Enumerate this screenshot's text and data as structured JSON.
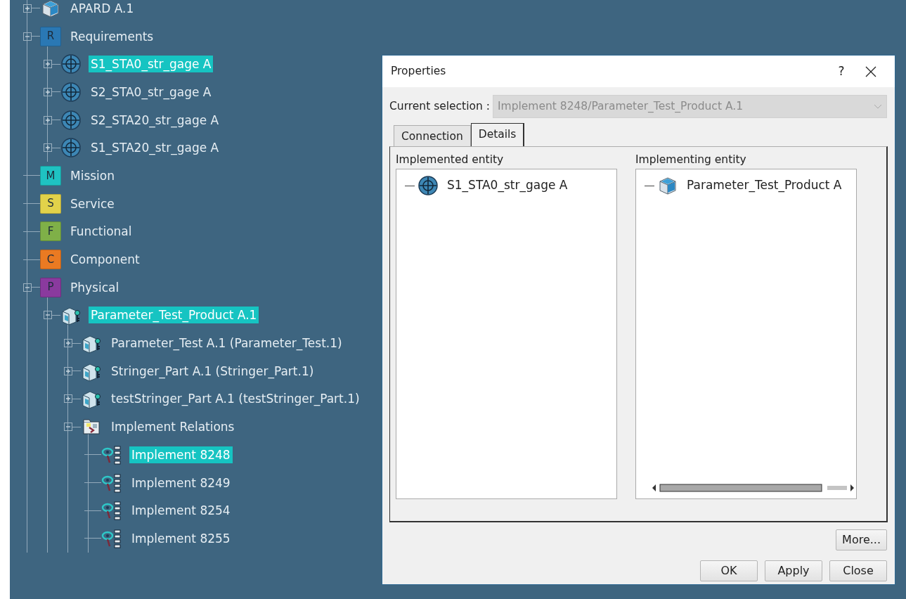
{
  "tree": [
    {
      "label": "APARD A.1",
      "kind": "product",
      "expanded": false,
      "selected": false
    },
    {
      "label": "Requirements",
      "kind": "letter",
      "letter": "R",
      "color": "#2a78b4",
      "expanded": true,
      "selected": false,
      "children": [
        {
          "label": "S1_STA0_str_gage A",
          "kind": "requirement",
          "expanded": false,
          "selected": true
        },
        {
          "label": "S2_STA0_str_gage A",
          "kind": "requirement",
          "expanded": false,
          "selected": false
        },
        {
          "label": "S2_STA20_str_gage A",
          "kind": "requirement",
          "expanded": false,
          "selected": false
        },
        {
          "label": "S1_STA20_str_gage A",
          "kind": "requirement",
          "expanded": false,
          "selected": false
        }
      ]
    },
    {
      "label": "Mission",
      "kind": "letter",
      "letter": "M",
      "color": "#1fc2c2",
      "selected": false
    },
    {
      "label": "Service",
      "kind": "letter",
      "letter": "S",
      "color": "#e2d24a",
      "selected": false
    },
    {
      "label": "Functional",
      "kind": "letter",
      "letter": "F",
      "color": "#7fb048",
      "selected": false
    },
    {
      "label": "Component",
      "kind": "letter",
      "letter": "C",
      "color": "#ea7a22",
      "selected": false
    },
    {
      "label": "Physical",
      "kind": "letter",
      "letter": "P",
      "color": "#8a3a9e",
      "expanded": true,
      "selected": false,
      "children": [
        {
          "label": "Parameter_Test_Product A.1",
          "kind": "part",
          "expanded": true,
          "selected": true,
          "children": [
            {
              "label": "Parameter_Test A.1 (Parameter_Test.1)",
              "kind": "part",
              "expanded": false,
              "selected": false
            },
            {
              "label": "Stringer_Part A.1 (Stringer_Part.1)",
              "kind": "part",
              "expanded": false,
              "selected": false
            },
            {
              "label": "testStringer_Part A.1 (testStringer_Part.1)",
              "kind": "part",
              "expanded": false,
              "selected": false
            },
            {
              "label": "Implement Relations",
              "kind": "folder",
              "expanded": true,
              "selected": false,
              "children": [
                {
                  "label": "Implement 8248",
                  "kind": "implement",
                  "selected": true
                },
                {
                  "label": "Implement 8249",
                  "kind": "implement",
                  "selected": false
                },
                {
                  "label": "Implement 8254",
                  "kind": "implement",
                  "selected": false
                },
                {
                  "label": "Implement 8255",
                  "kind": "implement",
                  "selected": false
                }
              ]
            }
          ]
        }
      ]
    }
  ],
  "dialog": {
    "title": "Properties",
    "help": "?",
    "selection_label": "Current selection :",
    "selection_value": "Implement 8248/Parameter_Test_Product A.1",
    "selection_disabled": true,
    "tabs": [
      {
        "label": "Connection",
        "selected": false
      },
      {
        "label": "Details",
        "selected": true
      }
    ],
    "panels": [
      {
        "heading": "Implemented entity",
        "item": {
          "label": "S1_STA0_str_gage A",
          "kind": "requirement"
        },
        "scrollbar": false
      },
      {
        "heading": "Implementing entity",
        "item": {
          "label": "Parameter_Test_Product A",
          "kind": "product"
        },
        "scrollbar": true
      }
    ],
    "more_button": "More...",
    "buttons": [
      "OK",
      "Apply",
      "Close"
    ]
  }
}
